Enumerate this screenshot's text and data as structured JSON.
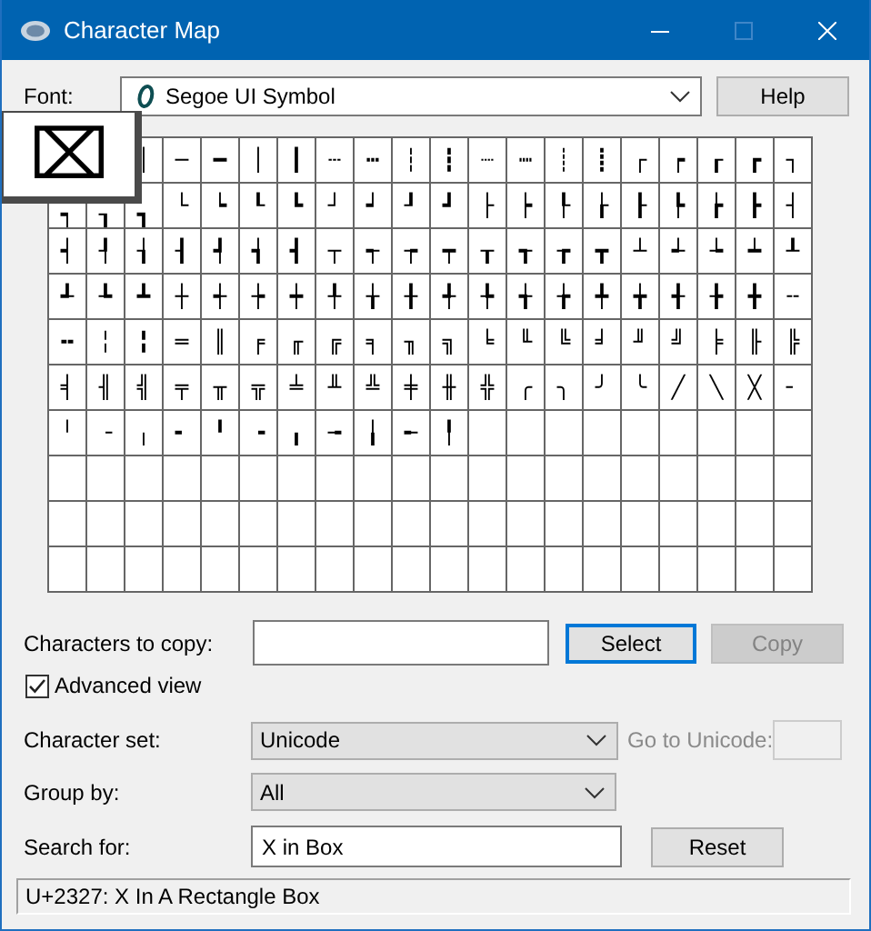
{
  "window": {
    "title": "Character Map"
  },
  "font": {
    "label": "Font:",
    "value": "Segoe UI Symbol",
    "kind": "font"
  },
  "help_button": {
    "label": "Help",
    "focused": false,
    "disabled": false
  },
  "grid": {
    "enlarged_char": "⌧",
    "rows": [
      [
        null,
        null,
        "│",
        "─",
        "━",
        "│",
        "┃",
        "┄",
        "┅",
        "┆",
        "┇",
        "┈",
        "┉",
        "┊",
        "┋",
        "┌",
        "┍",
        "┎",
        "┏",
        "┐"
      ],
      [
        "┑",
        "┒",
        "┓",
        "└",
        "┕",
        "┖",
        "┗",
        "┘",
        "┙",
        "┚",
        "┛",
        "├",
        "┝",
        "┞",
        "┟",
        "┠",
        "┡",
        "┢",
        "┣",
        "┤"
      ],
      [
        "┥",
        "┦",
        "┧",
        "┨",
        "┩",
        "┪",
        "┫",
        "┬",
        "┭",
        "┮",
        "┯",
        "┰",
        "┱",
        "┲",
        "┳",
        "┴",
        "┵",
        "┶",
        "┷",
        "┸"
      ],
      [
        "┹",
        "┺",
        "┻",
        "┼",
        "┽",
        "┾",
        "┿",
        "╀",
        "╁",
        "╂",
        "╃",
        "╄",
        "╅",
        "╆",
        "╇",
        "╈",
        "╉",
        "╊",
        "╋",
        "╌"
      ],
      [
        "╍",
        "╎",
        "╏",
        "═",
        "║",
        "╒",
        "╓",
        "╔",
        "╕",
        "╖",
        "╗",
        "╘",
        "╙",
        "╚",
        "╛",
        "╜",
        "╝",
        "╞",
        "╟",
        "╠"
      ],
      [
        "╡",
        "╢",
        "╣",
        "╤",
        "╥",
        "╦",
        "╧",
        "╨",
        "╩",
        "╪",
        "╫",
        "╬",
        "╭",
        "╮",
        "╯",
        "╰",
        "╱",
        "╲",
        "╳",
        "╴"
      ],
      [
        "╵",
        "╶",
        "╷",
        "╸",
        "╹",
        "╺",
        "╻",
        "╼",
        "╽",
        "╾",
        "╿"
      ]
    ]
  },
  "copy": {
    "label": "Characters to copy:"
  },
  "select_button": {
    "label": "Select",
    "focused": true,
    "disabled": false
  },
  "copy_button": {
    "label": "Copy",
    "focused": false,
    "disabled": true
  },
  "advanced_view": {
    "label": "Advanced view",
    "checked": true
  },
  "character_set": {
    "label": "Character set:",
    "value": "Unicode",
    "kind": "list"
  },
  "goto_unicode": {
    "label": "Go to Unicode:",
    "disabled": true
  },
  "group_by": {
    "label": "Group by:",
    "value": "All",
    "kind": "list"
  },
  "search": {
    "label": "Search for:",
    "value": "X in Box"
  },
  "reset_button": {
    "label": "Reset",
    "focused": false,
    "disabled": false
  },
  "status_bar": {
    "text": "U+2327: X In A Rectangle Box"
  }
}
